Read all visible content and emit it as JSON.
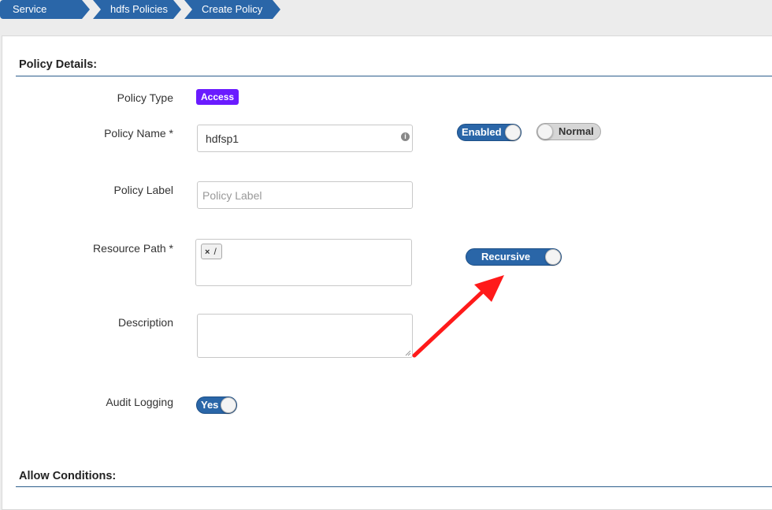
{
  "breadcrumb": [
    "Service Manager",
    "hdfs Policies",
    "Create Policy"
  ],
  "policy_details": {
    "title": "Policy Details:",
    "policy_type_label": "Policy Type",
    "policy_type_value": "Access",
    "policy_name_label": "Policy Name *",
    "policy_name_value": "hdfsp1",
    "policy_name_info_icon": "info-icon",
    "enabled_toggle": {
      "label": "Enabled",
      "state": "on"
    },
    "normal_toggle": {
      "label": "Normal",
      "state": "off"
    },
    "policy_label_label": "Policy Label",
    "policy_label_placeholder": "Policy Label",
    "resource_path_label": "Resource Path *",
    "resource_path_tags": [
      "/"
    ],
    "tag_remove_glyph": "×",
    "recursive_toggle": {
      "label": "Recursive",
      "state": "on"
    },
    "description_label": "Description",
    "description_value": "",
    "audit_logging_label": "Audit Logging",
    "audit_logging_toggle": {
      "label": "Yes",
      "state": "on"
    }
  },
  "allow_conditions": {
    "title": "Allow Conditions:"
  },
  "colors": {
    "accent": "#2a66a8",
    "access_badge": "#6a1bff",
    "annotation_arrow": "#ff1a1a"
  }
}
